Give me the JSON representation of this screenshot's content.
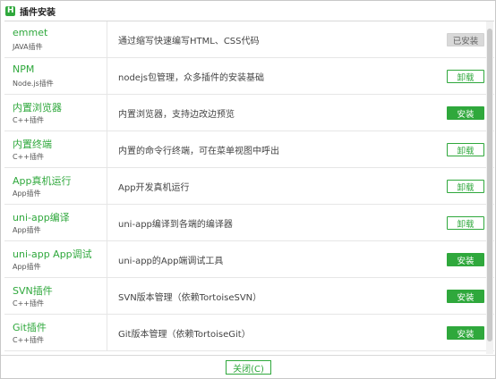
{
  "window": {
    "title": "插件安装"
  },
  "plugins": [
    {
      "name": "emmet",
      "type": "JAVA插件",
      "desc": "通过缩写快速编写HTML、CSS代码",
      "action": "已安装",
      "state": "installed"
    },
    {
      "name": "NPM",
      "type": "Node.js插件",
      "desc": "nodejs包管理，众多插件的安装基础",
      "action": "卸载",
      "state": "uninstall"
    },
    {
      "name": "内置浏览器",
      "type": "C++插件",
      "desc": "内置浏览器，支持边改边预览",
      "action": "安装",
      "state": "install"
    },
    {
      "name": "内置终端",
      "type": "C++插件",
      "desc": "内置的命令行终端，可在菜单视图中呼出",
      "action": "卸载",
      "state": "uninstall"
    },
    {
      "name": "App真机运行",
      "type": "App插件",
      "desc": "App开发真机运行",
      "action": "卸载",
      "state": "uninstall"
    },
    {
      "name": "uni-app编译",
      "type": "App插件",
      "desc": "uni-app编译到各端的编译器",
      "action": "卸载",
      "state": "uninstall"
    },
    {
      "name": "uni-app App调试",
      "type": "App插件",
      "desc": "uni-app的App端调试工具",
      "action": "安装",
      "state": "install"
    },
    {
      "name": "SVN插件",
      "type": "C++插件",
      "desc": "SVN版本管理（依赖TortoiseSVN）",
      "action": "安装",
      "state": "install"
    },
    {
      "name": "Git插件",
      "type": "C++插件",
      "desc": "Git版本管理（依赖TortoiseGit）",
      "action": "安装",
      "state": "install"
    }
  ],
  "footer": {
    "close_label": "关闭(C)"
  },
  "colors": {
    "accent": "#2fa83c",
    "installed_bg": "#d9d9d9"
  },
  "icons": {
    "app": "hbuilder-logo-icon"
  }
}
